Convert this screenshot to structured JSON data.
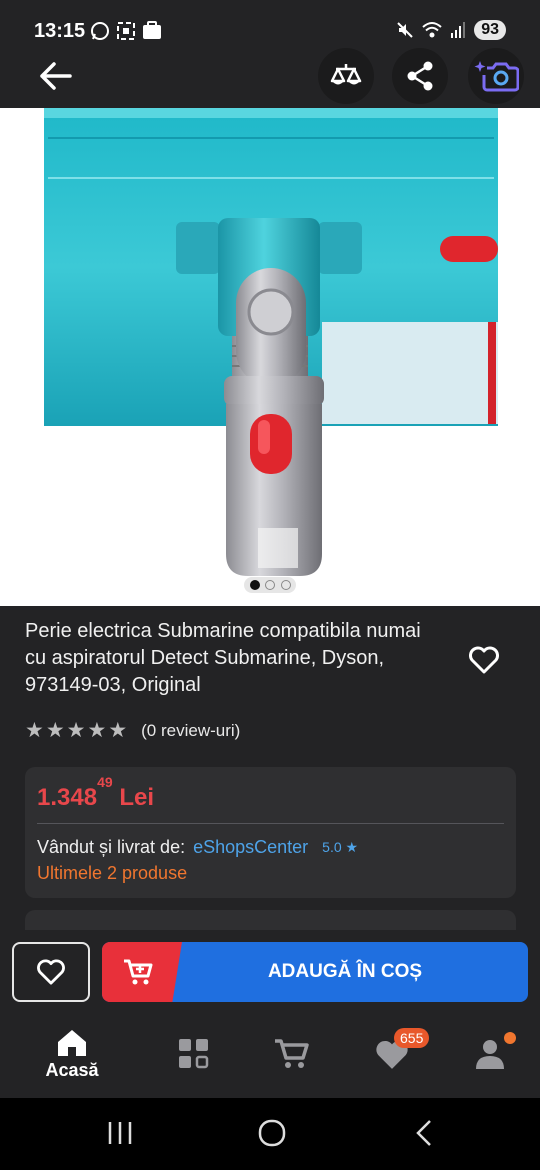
{
  "status_bar": {
    "time": "13:15",
    "battery": "93",
    "icons_left": [
      "whatsapp-icon",
      "screenshot-icon",
      "emag-icon"
    ],
    "icons_right": [
      "mute-icon",
      "wifi-icon",
      "signal-icon",
      "battery-icon"
    ]
  },
  "top_bar": {
    "back": "arrow-left-icon",
    "actions": [
      "compare-icon",
      "share-icon",
      "camera-search-icon"
    ]
  },
  "gallery": {
    "image": "dyson-submarine-brush-head",
    "dot_count": 3,
    "active_dot": 0
  },
  "product": {
    "title": "Perie electrica Submarine compatibila numai cu aspiratorul Detect Submarine, Dyson, 973149-03, Original",
    "rating_stars": 0,
    "rating_text": "(0 review-uri)"
  },
  "price_card": {
    "price_main": "1.348",
    "price_cents": "49",
    "currency": "Lei",
    "sold_by_label": "Vândut și livrat de:",
    "seller": "eShopsCenter",
    "seller_rating": "5.0",
    "stock_text": "Ultimele 2 produse"
  },
  "action_bar": {
    "add_to_cart_label": "ADAUGĂ ÎN COȘ"
  },
  "bottom_nav": {
    "home_label": "Acasă",
    "favorites_badge": "655"
  },
  "colors": {
    "accent_blue": "#1f6fe0",
    "accent_red": "#e8303a",
    "price_red": "#e8474b",
    "link_blue": "#4ea3e8",
    "stock_orange": "#f0762f"
  }
}
